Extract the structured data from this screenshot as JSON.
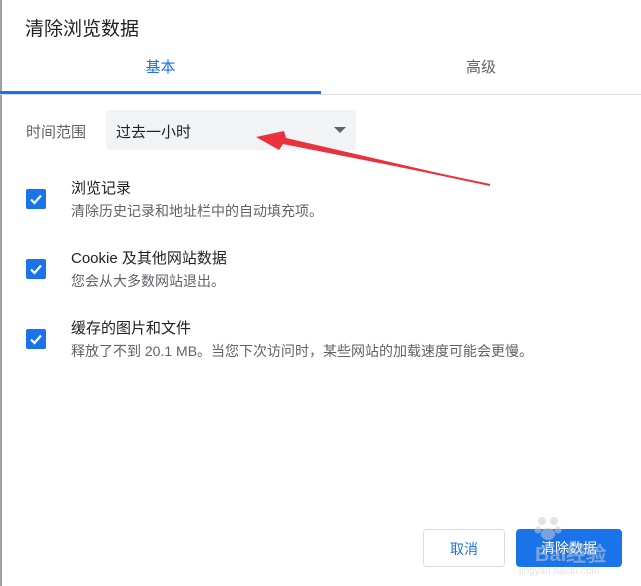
{
  "dialog": {
    "title": "清除浏览数据"
  },
  "tabs": [
    {
      "label": "基本",
      "active": true
    },
    {
      "label": "高级",
      "active": false
    }
  ],
  "time_range": {
    "label": "时间范围",
    "selected": "过去一小时"
  },
  "options": [
    {
      "title": "浏览记录",
      "description": "清除历史记录和地址栏中的自动填充项。",
      "checked": true
    },
    {
      "title": "Cookie 及其他网站数据",
      "description": "您会从大多数网站退出。",
      "checked": true
    },
    {
      "title": "缓存的图片和文件",
      "description": "释放了不到 20.1 MB。当您下次访问时，某些网站的加载速度可能会更慢。",
      "checked": true
    }
  ],
  "buttons": {
    "cancel": "取消",
    "clear": "清除数据"
  },
  "watermark": {
    "brand": "Bai经验",
    "url": "jingyan.baidu.com"
  },
  "colors": {
    "accent": "#1a73e8",
    "annotation_arrow": "#e8323c"
  }
}
